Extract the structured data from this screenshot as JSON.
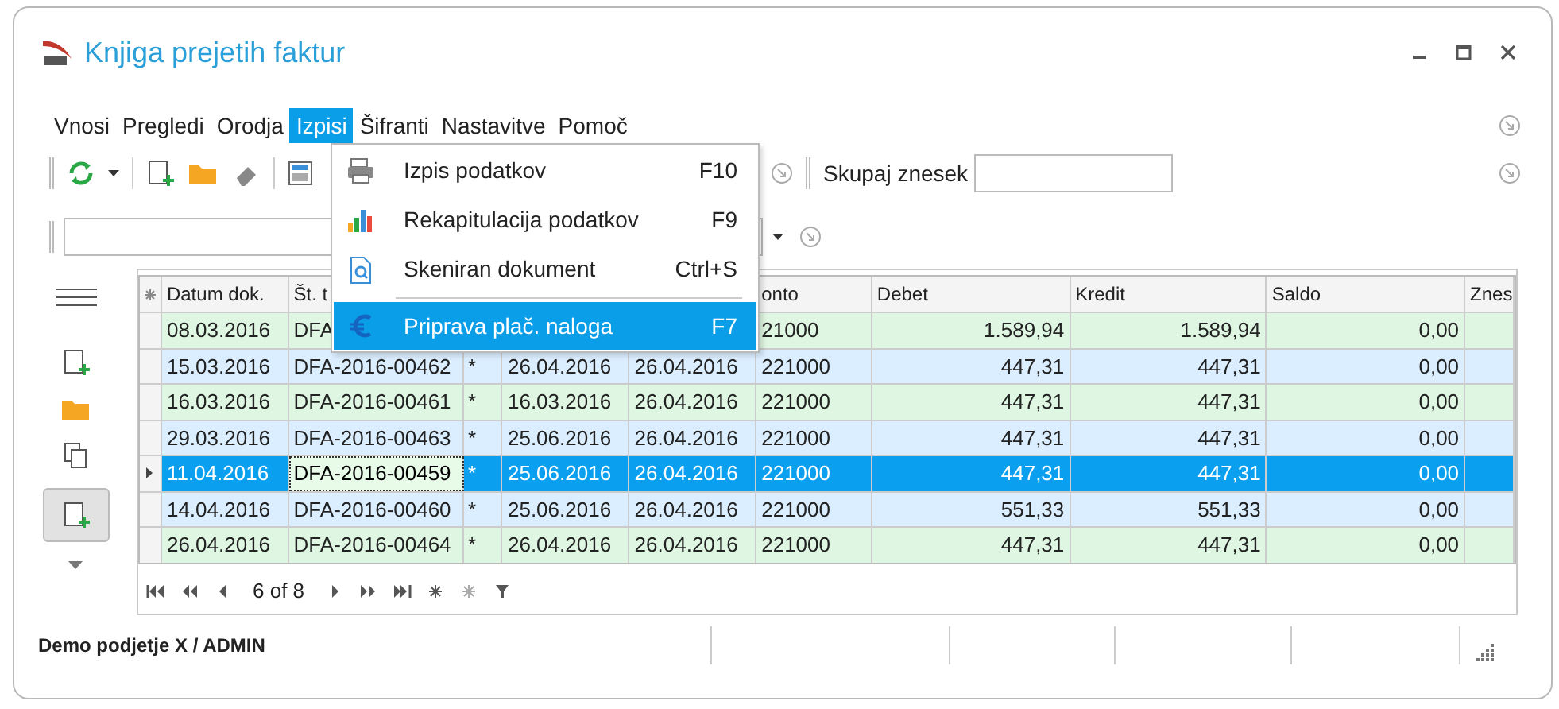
{
  "window": {
    "title": "Knjiga prejetih faktur"
  },
  "menu_bar": [
    {
      "label": "Vnosi",
      "selected": false
    },
    {
      "label": "Pregledi",
      "selected": false
    },
    {
      "label": "Orodja",
      "selected": false
    },
    {
      "label": "Izpisi",
      "selected": true
    },
    {
      "label": "Šifranti",
      "selected": false
    },
    {
      "label": "Nastavitve",
      "selected": false
    },
    {
      "label": "Pomoč",
      "selected": false
    }
  ],
  "menu": [
    {
      "kind": "print",
      "label": "Izpis podatkov",
      "shortcut": "F10",
      "selected": false
    },
    {
      "kind": "chart",
      "label": "Rekapitulacija podatkov",
      "shortcut": "F9",
      "selected": false
    },
    {
      "kind": "scan",
      "label": "Skeniran dokument",
      "shortcut": "Ctrl+S",
      "selected": false
    },
    {
      "kind": "euro",
      "label": "Priprava plač. naloga",
      "shortcut": "F7",
      "selected": true
    }
  ],
  "toolbar": {
    "total_label": "Skupaj znesek"
  },
  "grid": {
    "columns": [
      "Datum dok.",
      "Št. t",
      "",
      "",
      "",
      "onto",
      "Debet",
      "Kredit",
      "Saldo",
      "Znes"
    ],
    "rows": [
      {
        "cells": [
          "08.03.2016",
          "DFA",
          "",
          "",
          "",
          "21000",
          "1.589,94",
          "1.589,94",
          "0,00"
        ],
        "color": "#dff7e2",
        "selected": false
      },
      {
        "cells": [
          "15.03.2016",
          "DFA-2016-00462",
          "*",
          "26.04.2016",
          "26.04.2016",
          "221000",
          "447,31",
          "447,31",
          "0,00"
        ],
        "color": "#dbeeff",
        "selected": false
      },
      {
        "cells": [
          "16.03.2016",
          "DFA-2016-00461",
          "*",
          "16.03.2016",
          "26.04.2016",
          "221000",
          "447,31",
          "447,31",
          "0,00"
        ],
        "color": "#dff7e2",
        "selected": false
      },
      {
        "cells": [
          "29.03.2016",
          "DFA-2016-00463",
          "*",
          "25.06.2016",
          "26.04.2016",
          "221000",
          "447,31",
          "447,31",
          "0,00"
        ],
        "color": "#dbeeff",
        "selected": false
      },
      {
        "cells": [
          "11.04.2016",
          "DFA-2016-00459",
          "*",
          "25.06.2016",
          "26.04.2016",
          "221000",
          "447,31",
          "447,31",
          "0,00"
        ],
        "selected": true
      },
      {
        "cells": [
          "14.04.2016",
          "DFA-2016-00460",
          "*",
          "25.06.2016",
          "26.04.2016",
          "221000",
          "551,33",
          "551,33",
          "0,00"
        ],
        "color": "#dbeeff",
        "selected": false
      },
      {
        "cells": [
          "26.04.2016",
          "DFA-2016-00464",
          "*",
          "26.04.2016",
          "26.04.2016",
          "221000",
          "447,31",
          "447,31",
          "0,00"
        ],
        "color": "#dff7e2",
        "selected": false
      }
    ],
    "position": "6 of 8"
  },
  "status_bar": {
    "company": "Demo podjetje X / ADMIN"
  }
}
